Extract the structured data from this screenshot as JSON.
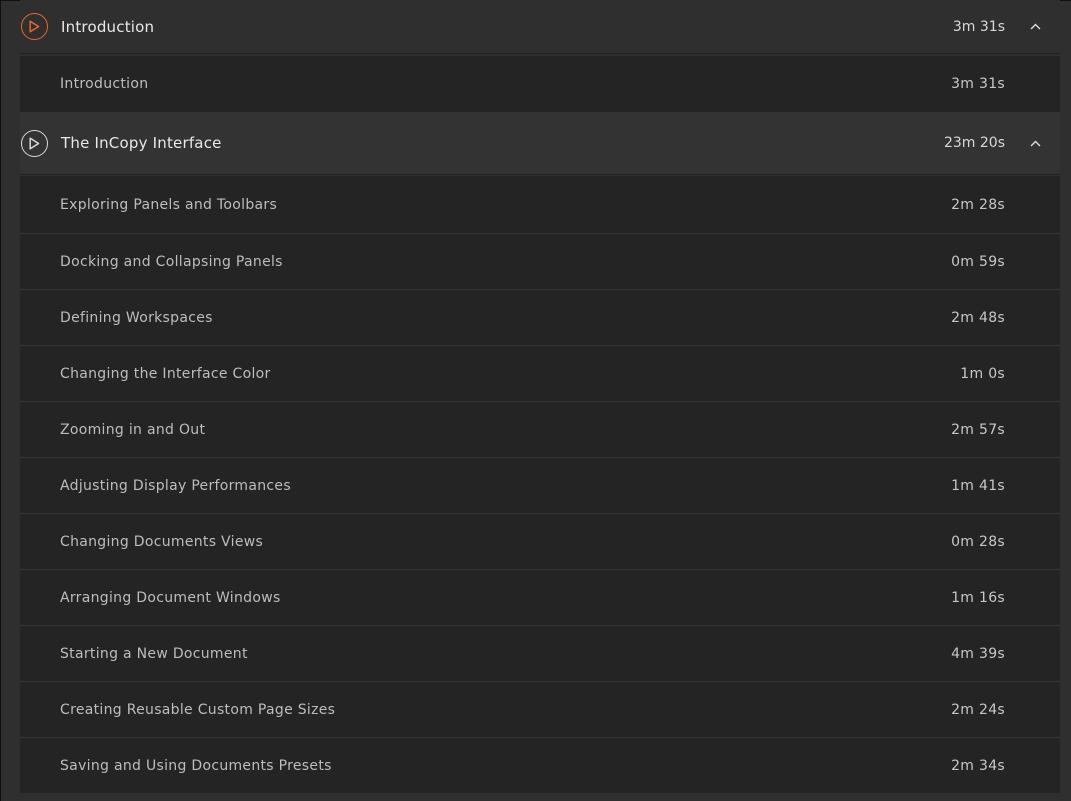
{
  "sections": [
    {
      "title": "Introduction",
      "duration": "3m 31s",
      "accent": "#e8672c",
      "lessons": [
        {
          "title": "Introduction",
          "duration": "3m 31s"
        }
      ]
    },
    {
      "title": "The InCopy Interface",
      "duration": "23m 20s",
      "accent": "#d8d8d8",
      "lessons": [
        {
          "title": "Exploring Panels and Toolbars",
          "duration": "2m 28s"
        },
        {
          "title": "Docking and Collapsing Panels",
          "duration": "0m 59s"
        },
        {
          "title": "Defining Workspaces",
          "duration": "2m 48s"
        },
        {
          "title": "Changing the Interface Color",
          "duration": "1m 0s"
        },
        {
          "title": "Zooming in and Out",
          "duration": "2m 57s"
        },
        {
          "title": "Adjusting Display Performances",
          "duration": "1m 41s"
        },
        {
          "title": "Changing Documents Views",
          "duration": "0m 28s"
        },
        {
          "title": "Arranging Document Windows",
          "duration": "1m 16s"
        },
        {
          "title": "Starting a New Document",
          "duration": "4m 39s"
        },
        {
          "title": "Creating Reusable Custom Page Sizes",
          "duration": "2m 24s"
        },
        {
          "title": "Saving and Using Documents Presets",
          "duration": "2m 34s"
        }
      ]
    }
  ],
  "icons": {
    "play": "play-circle-icon",
    "collapse": "chevron-up-icon"
  }
}
